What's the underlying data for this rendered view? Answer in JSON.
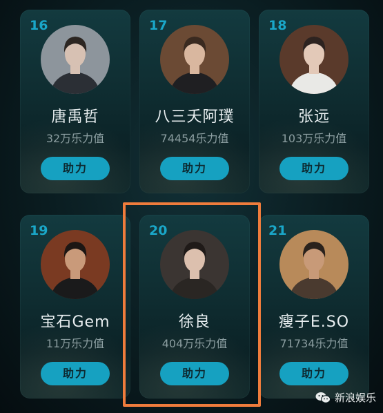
{
  "cards": [
    {
      "rank": "16",
      "name": "唐禹哲",
      "score": "32万乐力值",
      "button": "助力",
      "avatar_bg": "#8d959c",
      "face": "#d7c1b3",
      "hair": "#2c2622",
      "shirt": "#2b2f35"
    },
    {
      "rank": "17",
      "name": "八三夭阿璞",
      "score": "74454乐力值",
      "button": "助力",
      "avatar_bg": "#6b4a34",
      "face": "#d9b79f",
      "hair": "#3a2a20",
      "shirt": "#1f1f22"
    },
    {
      "rank": "18",
      "name": "张远",
      "score": "103万乐力值",
      "button": "助力",
      "avatar_bg": "#5a3a2b",
      "face": "#e3c9b8",
      "hair": "#2d2320",
      "shirt": "#e9e9e6"
    },
    {
      "rank": "19",
      "name": "宝石Gem",
      "score": "11万乐力值",
      "button": "助力",
      "avatar_bg": "#7a3a22",
      "face": "#c99a7a",
      "hair": "#1c1614",
      "shirt": "#1a1a1b"
    },
    {
      "rank": "20",
      "name": "徐良",
      "score": "404万乐力值",
      "button": "助力",
      "avatar_bg": "#3b3532",
      "face": "#dcc0ae",
      "hair": "#1f1a18",
      "shirt": "#2a2623"
    },
    {
      "rank": "21",
      "name": "瘦子E.SO",
      "score": "71734乐力值",
      "button": "助力",
      "avatar_bg": "#b88a5a",
      "face": "#c89a78",
      "hair": "#2a221c",
      "shirt": "#4a3a2f"
    }
  ],
  "highlight_color": "#ef7c3c",
  "accent": "#16a1c1",
  "watermark": {
    "text": "新浪娱乐",
    "icon": "wechat-icon"
  }
}
